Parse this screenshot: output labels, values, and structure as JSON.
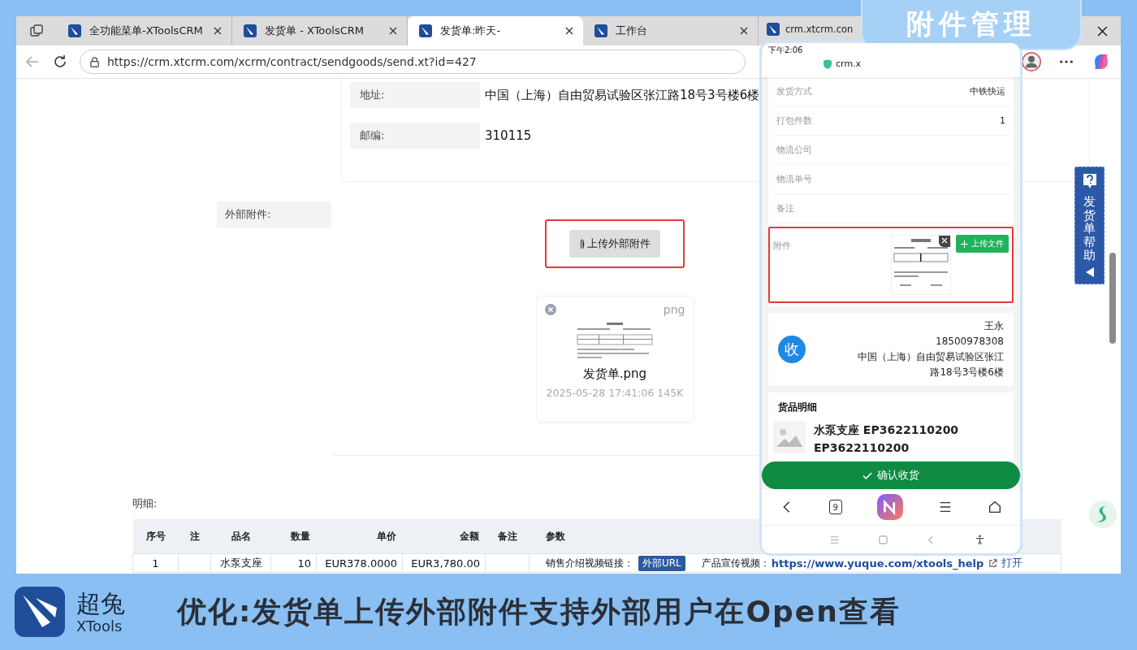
{
  "browser": {
    "tabs": [
      {
        "label": "全功能菜单-XToolsCRM",
        "selected": false
      },
      {
        "label": "发货单 - XToolsCRM",
        "selected": false
      },
      {
        "label": "发货单:昨天-",
        "selected": true
      },
      {
        "label": "工作台",
        "selected": false
      },
      {
        "label": "crm.xtcrm.con",
        "selected": false
      }
    ],
    "url": "https://crm.xtcrm.com/xcrm/contract/sendgoods/send.xt?id=427"
  },
  "form": {
    "fields": [
      {
        "label": "地址:",
        "value": "中国（上海）自由贸易试验区张江路18号3号楼6楼"
      },
      {
        "label": "邮编:",
        "value": "310115"
      }
    ],
    "attachment_label": "外部附件:",
    "upload_button": "上传外部附件",
    "file": {
      "ext": "png",
      "name": "发货单.png",
      "meta": "2025-05-28 17:41:06 145K"
    }
  },
  "details": {
    "label": "明细:",
    "columns": [
      {
        "label": "序号"
      },
      {
        "label": "注"
      },
      {
        "label": "品名"
      },
      {
        "label": "数量"
      },
      {
        "label": "单价"
      },
      {
        "label": "金额"
      },
      {
        "label": "备注"
      },
      {
        "label": "参数"
      }
    ],
    "rows": [
      {
        "no": "1",
        "name": "水泵支座",
        "qty": "10",
        "price": "EUR378.0000",
        "amount": "EUR3,780.00",
        "params": {
          "label1": "销售介绍视频链接：",
          "tag": "外部URL",
          "label2": "产品宣传视频：",
          "link": "https://www.yuque.com/xtools_help",
          "open": "打开"
        }
      }
    ]
  },
  "help_tab": "发货单帮助",
  "phone": {
    "time": "下午2:06",
    "url": "crm.x",
    "rows": [
      {
        "label": "发货方式",
        "value": "中铁快运"
      },
      {
        "label": "打包件数",
        "value": "1"
      },
      {
        "label": "物流公司"
      },
      {
        "label": "物流单号"
      },
      {
        "label": "备注"
      }
    ],
    "attachment": {
      "label": "附件",
      "upload_button": "上传文件"
    },
    "receiver": {
      "badge": "收",
      "name": "王永",
      "phone": "18500978308",
      "address": "中国（上海）自由贸易试验区张江路18号3号楼6楼"
    },
    "goods": {
      "title": "货品明细",
      "item": "水泵支座 EP3622110200 EP3622110200"
    },
    "confirm_button": "确认收货",
    "tab_count": "9"
  },
  "banner_label": "附件管理",
  "footer": {
    "brand_cn": "超兔",
    "brand_en": "XTools",
    "headline": "优化:发货单上传外部附件支持外部用户在Open查看"
  }
}
